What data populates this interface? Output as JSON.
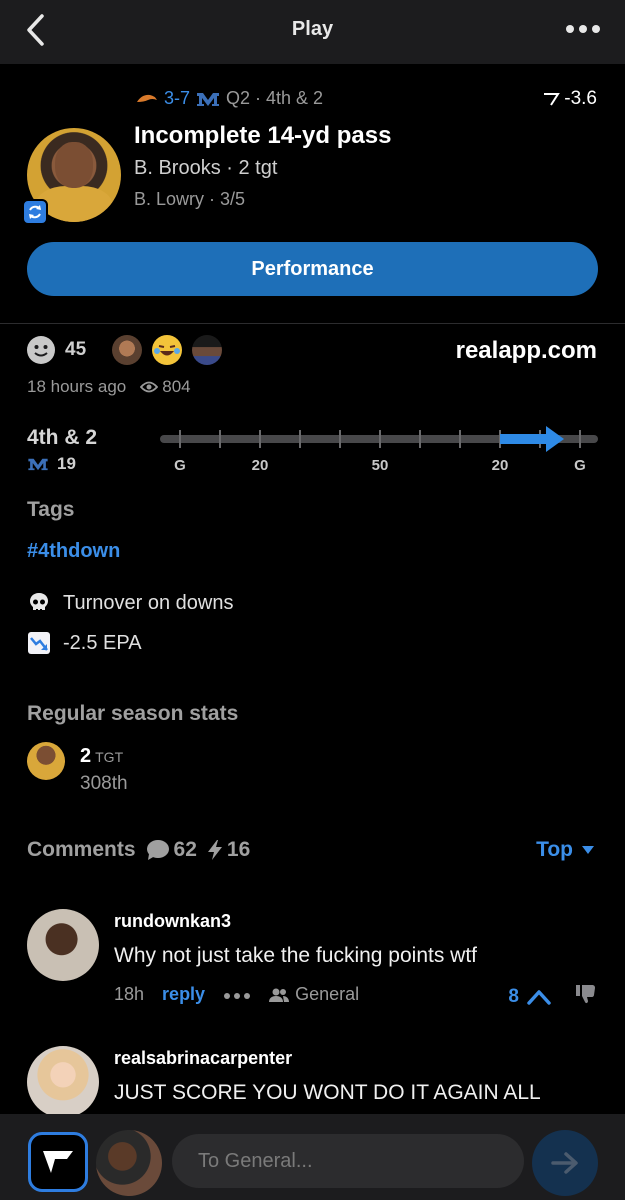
{
  "header": {
    "title": "Play",
    "back_icon": "chevron-left-icon",
    "more_icon": "ellipsis-icon"
  },
  "game": {
    "score": "3-7",
    "quarter_down": "Q2 · 4th & 2",
    "odds": "-3.6"
  },
  "play": {
    "title": "Incomplete 14-yd pass",
    "receiver": "B. Brooks · 2 tgt",
    "passer": "B. Lowry · 3/5",
    "performance_label": "Performance"
  },
  "reactions": {
    "count": "45",
    "domain": "realapp.com",
    "time_ago": "18 hours ago",
    "views": "804"
  },
  "field": {
    "down": "4th & 2",
    "yard_line": "19",
    "labels": [
      "G",
      "20",
      "50",
      "20",
      "G"
    ]
  },
  "tags": {
    "heading": "Tags",
    "items": [
      "#4thdown"
    ]
  },
  "notes": [
    {
      "icon": "skull-icon",
      "text": "Turnover on downs"
    },
    {
      "icon": "chart-down-icon",
      "text": "-2.5 EPA"
    }
  ],
  "season": {
    "heading": "Regular season stats",
    "value": "2",
    "unit": "TGT",
    "rank": "308th"
  },
  "comments": {
    "heading": "Comments",
    "count": "62",
    "boosts": "16",
    "sort": "Top",
    "items": [
      {
        "user": "rundownkan3",
        "text": "Why not just take the fucking points wtf",
        "time": "18h",
        "reply": "reply",
        "channel": "General",
        "votes": "8"
      },
      {
        "user": "realsabrinacarpenter",
        "text": "JUST SCORE YOU WONT DO IT AGAIN ALL"
      }
    ]
  },
  "composer": {
    "placeholder": "To General..."
  },
  "colors": {
    "accent": "#3b8ee8",
    "button": "#1e6fb8",
    "background": "#000000",
    "bar": "#1c1c1e"
  }
}
